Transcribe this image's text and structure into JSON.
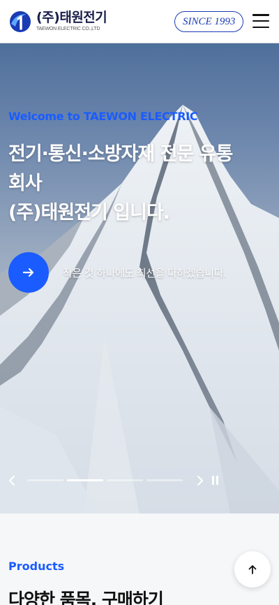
{
  "header": {
    "logo_korean": "(주)태원전기",
    "logo_english": "TAEWON ELECTRIC CO.,LTD",
    "since_badge": "SINCE 1993",
    "menu_icon": "hamburger-icon"
  },
  "hero": {
    "welcome": "Welcome to TAEWON ELECTRIC",
    "title_line1": "전기·통신·소방자재 전문 유통",
    "title_line2": "회사",
    "title_line3": "(주)태원전기 입니다.",
    "subtitle": "작은 것 하나에도 최선을 다하겠습니다.",
    "cta_icon": "arrow-right-icon",
    "slides_total": 4,
    "slide_active": 2
  },
  "products": {
    "label": "Products",
    "title": "다양한 품목, 구매하기"
  },
  "colors": {
    "accent": "#1a5cff",
    "brand_navy": "#1a1f4b",
    "badge": "#1a3bb3"
  }
}
